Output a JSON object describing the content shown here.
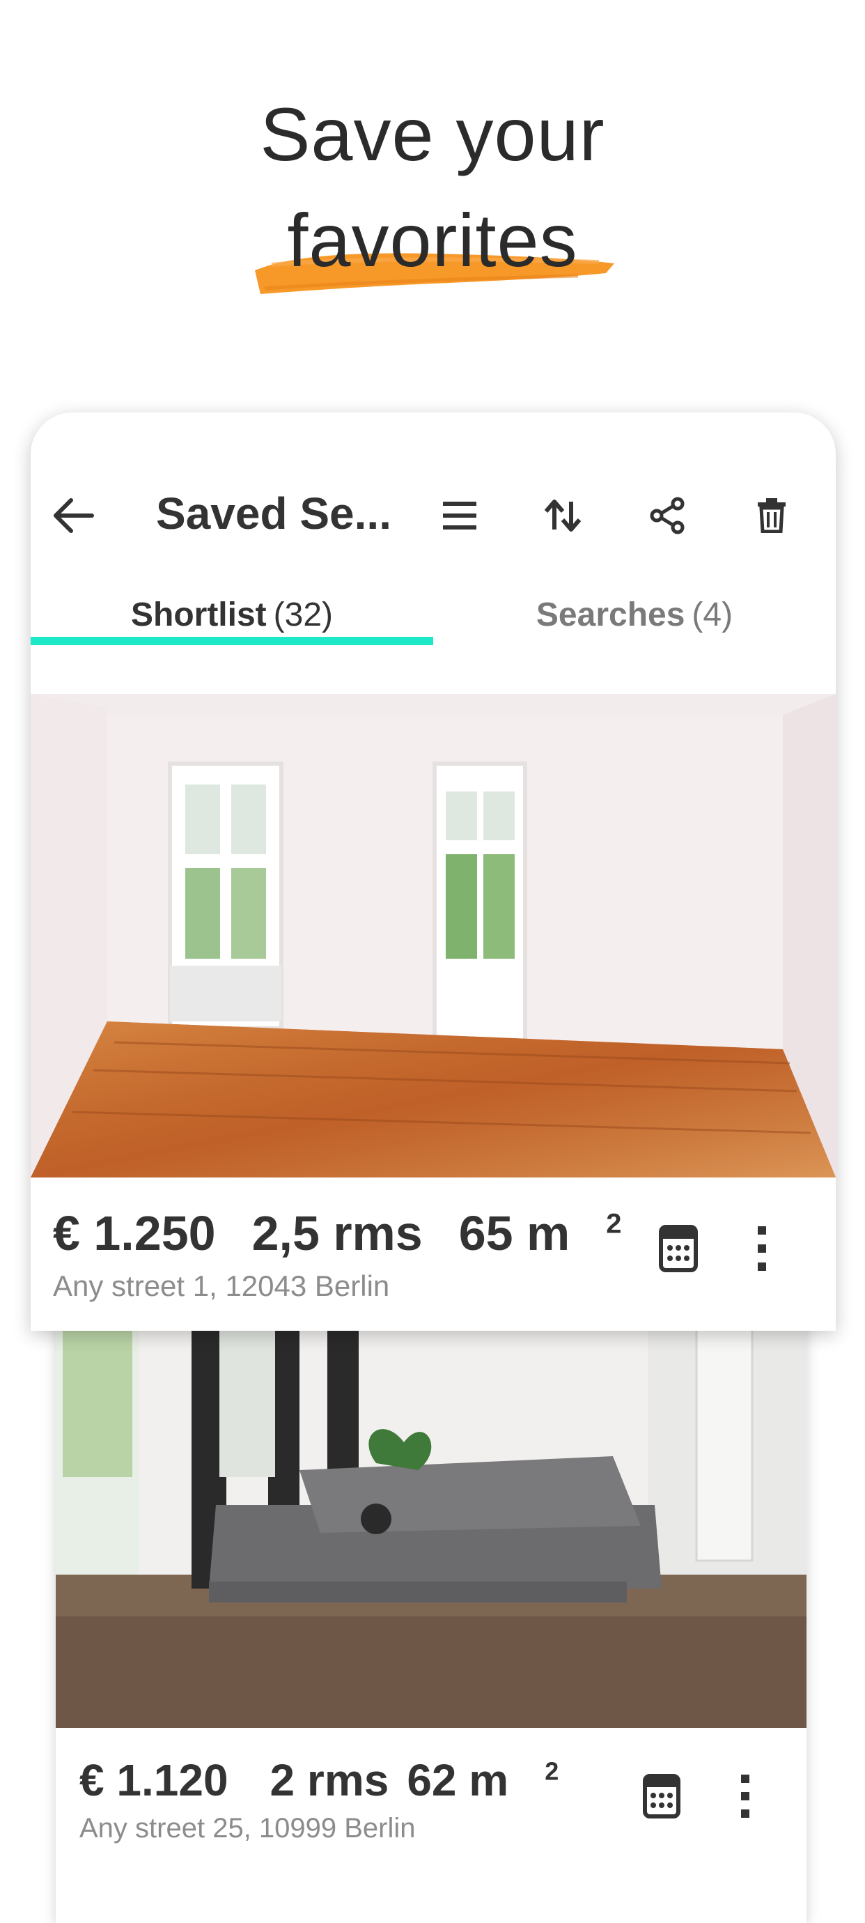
{
  "headline": {
    "line1": "Save your",
    "line2": "favorites"
  },
  "colors": {
    "accent_tab": "#1de9c9",
    "brush": "#f7931e",
    "text": "#333333",
    "muted": "#8c8c8c"
  },
  "toolbar": {
    "title": "Saved Se...",
    "icons": [
      "back-arrow-icon",
      "list-icon",
      "sort-icon",
      "share-icon",
      "trash-icon"
    ]
  },
  "tabs": [
    {
      "label": "Shortlist",
      "count": "(32)",
      "active": true
    },
    {
      "label": "Searches",
      "count": "(4)",
      "active": false
    }
  ],
  "listings": [
    {
      "price": "€ 1.250",
      "rooms": "2,5 rms",
      "area": "65 m",
      "area_unit_sup": "2",
      "address": "Any street 1, 12043 Berlin"
    },
    {
      "price": "€ 1.120",
      "rooms": "2 rms",
      "area": "62 m",
      "area_unit_sup": "2",
      "address": "Any street 25, 10999 Berlin"
    }
  ]
}
